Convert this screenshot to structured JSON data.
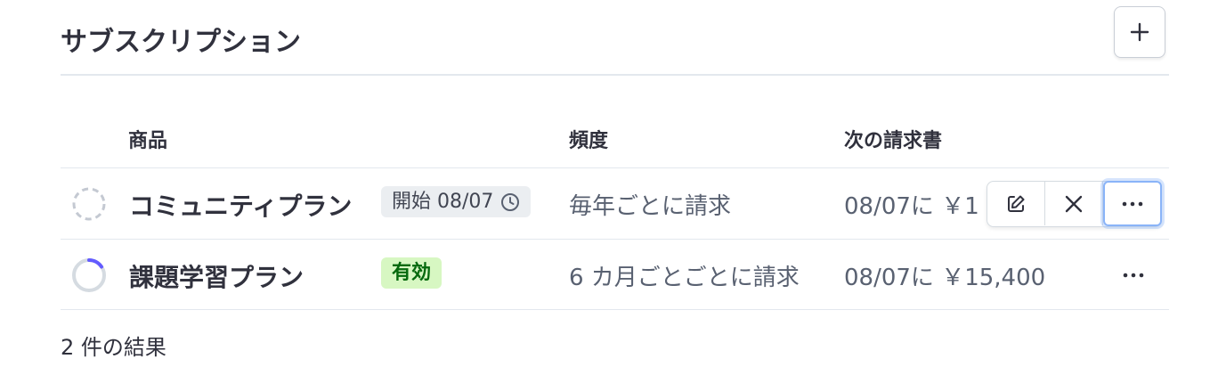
{
  "header": {
    "title": "サブスクリプション",
    "add_icon": "plus-icon"
  },
  "columns": {
    "product": "商品",
    "frequency": "頻度",
    "next_invoice": "次の請求書"
  },
  "rows": [
    {
      "status_icon": "dashed-circle-icon",
      "name": "コミュニティプラン",
      "badge": "開始 08/07",
      "badge_icon": "clock-icon",
      "frequency": "毎年ごとに請求",
      "next_invoice": "08/07に ￥1",
      "actions": [
        "edit-icon",
        "close-icon",
        "more-icon"
      ]
    },
    {
      "status_icon": "progress-ring-icon",
      "name": "課題学習プラン",
      "badge": "有効",
      "frequency": "6 カ月ごとごとに請求",
      "next_invoice": "08/07に ￥15,400",
      "actions": [
        "more-icon"
      ]
    }
  ],
  "footer": {
    "result_count": "2 件の結果"
  },
  "colors": {
    "text": "#30313d",
    "muted": "#596171",
    "border": "#e3e8ee",
    "badge_green_bg": "#d7f7c2",
    "badge_green_text": "#05690d",
    "badge_gray_bg": "#ebeef1",
    "accent": "#635bff",
    "focus": "#8ab4f8"
  }
}
